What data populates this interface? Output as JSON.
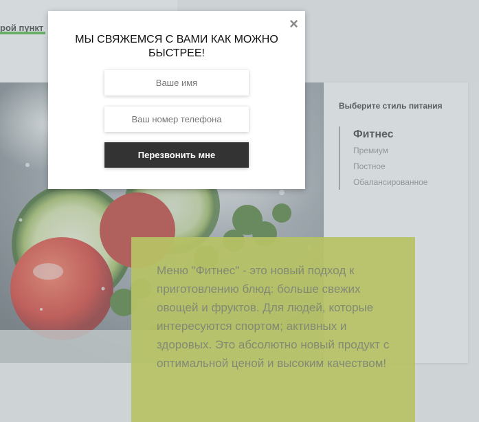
{
  "header": {
    "nav_fragment": "рой пункт"
  },
  "diet": {
    "title": "Выберите стиль питания",
    "items": [
      {
        "label": "Фитнес",
        "active": true
      },
      {
        "label": "Премиум",
        "active": false
      },
      {
        "label": "Постное",
        "active": false
      },
      {
        "label": "Обалансированное",
        "active": false
      }
    ]
  },
  "description": {
    "text": "Меню \"Фитнес\" - это новый подход к приготовлению блюд: больше свежих овощей и фруктов. Для людей, которые интересуются спортом; активных и здоровых. Это абсолютно новый продукт с оптимальной ценой и высоким качеством!"
  },
  "modal": {
    "close_icon": "×",
    "title": "МЫ СВЯЖЕМСЯ С ВАМИ КАК МОЖНО БЫСТРЕЕ!",
    "name_placeholder": "Ваше имя",
    "phone_placeholder": "Ваш номер телефона",
    "submit_label": "Перезвонить мне"
  },
  "colors": {
    "accent_green": "#3fae2e",
    "description_bg": "#cbd628",
    "button_bg": "#333333"
  }
}
